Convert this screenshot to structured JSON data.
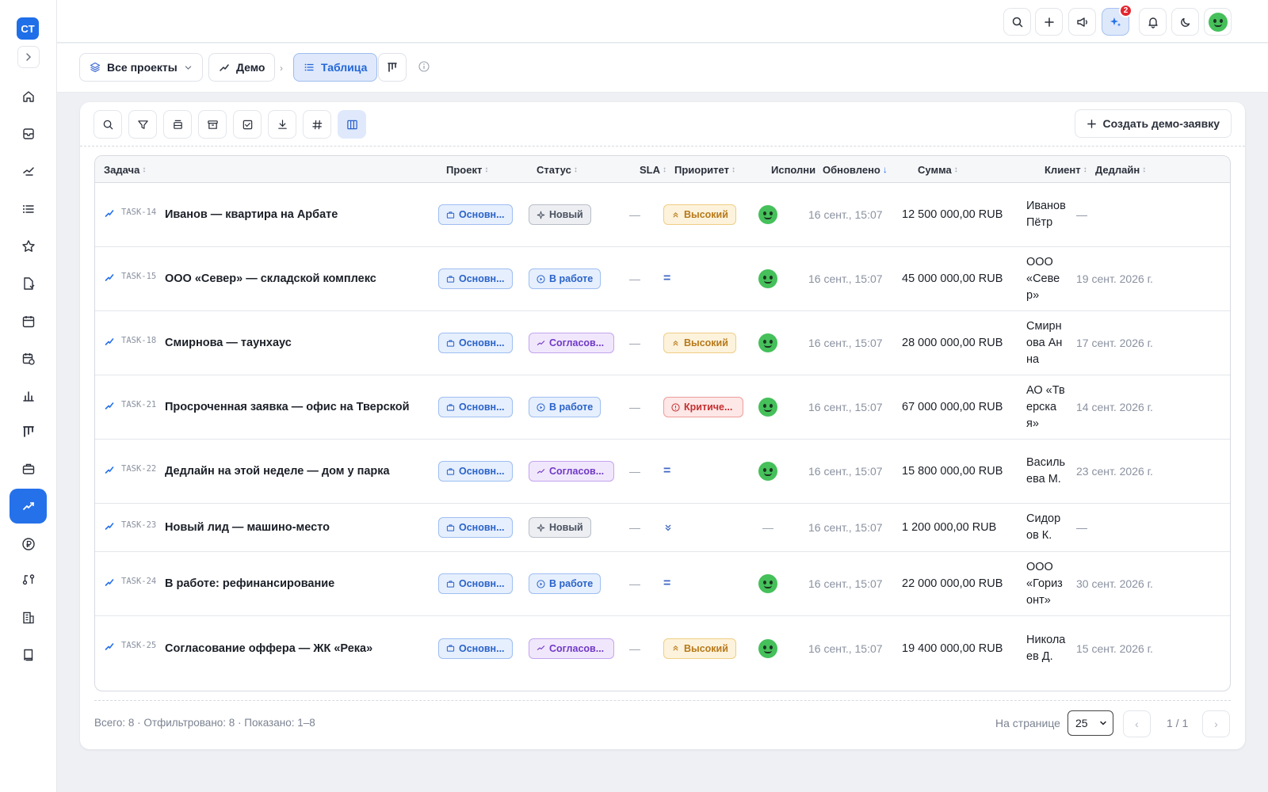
{
  "app": {
    "logo_text": "CT"
  },
  "sidebar": {
    "items": [
      {
        "icon": "home-icon"
      },
      {
        "icon": "inbox-icon"
      },
      {
        "icon": "handshake-icon"
      },
      {
        "icon": "list-icon"
      },
      {
        "icon": "star-icon"
      },
      {
        "icon": "document-icon"
      },
      {
        "icon": "calendar-icon"
      },
      {
        "icon": "calendar-clock-icon"
      },
      {
        "icon": "bar-chart-icon"
      },
      {
        "icon": "kanban-icon"
      },
      {
        "icon": "briefcase-icon"
      },
      {
        "icon": "deals-icon",
        "active": true
      },
      {
        "icon": "ruble-icon"
      },
      {
        "icon": "workflow-icon"
      },
      {
        "icon": "building-icon"
      },
      {
        "icon": "book-icon"
      }
    ]
  },
  "topbar": {
    "notification_count": "2"
  },
  "breadcrumb": {
    "projects": "Все проекты",
    "demo": "Демо",
    "table": "Таблица"
  },
  "toolbar": {
    "create_button": "Создать демо-заявку"
  },
  "table": {
    "columns": {
      "task": "Задача",
      "project": "Проект",
      "status": "Статус",
      "sla": "SLA",
      "priority": "Приоритет",
      "assignee": "Исполни",
      "updated": "Обновлено",
      "amount": "Сумма",
      "client": "Клиент",
      "deadline": "Дедлайн"
    },
    "rows": [
      {
        "id": "TASK-14",
        "title": "Иванов — квартира на Арбате",
        "project": "Основн...",
        "status": "Новый",
        "status_type": "new",
        "sla": "—",
        "priority": "Высокий",
        "priority_type": "high",
        "assignee": true,
        "updated": "16 сент., 15:07",
        "amount": "12 500 000,00 RUB",
        "client": "Иванов Пётр",
        "deadline": "—"
      },
      {
        "id": "TASK-15",
        "title": "ООО «Север» — складской комплекс",
        "project": "Основн...",
        "status": "В работе",
        "status_type": "work",
        "sla": "—",
        "priority": "=",
        "priority_type": "medium",
        "assignee": true,
        "updated": "16 сент., 15:07",
        "amount": "45 000 000,00 RUB",
        "client": "ООО «Север»",
        "deadline": "19 сент. 2026 г."
      },
      {
        "id": "TASK-18",
        "title": "Смирнова — таунхаус",
        "project": "Основн...",
        "status": "Согласов...",
        "status_type": "agree",
        "sla": "—",
        "priority": "Высокий",
        "priority_type": "high",
        "assignee": true,
        "updated": "16 сент., 15:07",
        "amount": "28 000 000,00 RUB",
        "client": "Смирнова Анна",
        "deadline": "17 сент. 2026 г."
      },
      {
        "id": "TASK-21",
        "title": "Просроченная заявка — офис на Тверской",
        "project": "Основн...",
        "status": "В работе",
        "status_type": "work",
        "sla": "—",
        "priority": "Критиче...",
        "priority_type": "critical",
        "assignee": true,
        "updated": "16 сент., 15:07",
        "amount": "67 000 000,00 RUB",
        "client": "АО «Тверская»",
        "deadline": "14 сент. 2026 г."
      },
      {
        "id": "TASK-22",
        "title": "Дедлайн на этой неделе — дом у парка",
        "project": "Основн...",
        "status": "Согласов...",
        "status_type": "agree",
        "sla": "—",
        "priority": "=",
        "priority_type": "medium",
        "assignee": true,
        "updated": "16 сент., 15:07",
        "amount": "15 800 000,00 RUB",
        "client": "Васильева М.",
        "deadline": "23 сент. 2026 г."
      },
      {
        "id": "TASK-23",
        "title": "Новый лид — машино-место",
        "project": "Основн...",
        "status": "Новый",
        "status_type": "new",
        "sla": "—",
        "priority": "low",
        "priority_type": "low",
        "assignee": false,
        "assignee_text": "—",
        "updated": "16 сент., 15:07",
        "amount": "1 200 000,00 RUB",
        "client": "Сидоров К.",
        "deadline": "—"
      },
      {
        "id": "TASK-24",
        "title": "В работе: рефинансирование",
        "project": "Основн...",
        "status": "В работе",
        "status_type": "work",
        "sla": "—",
        "priority": "=",
        "priority_type": "medium",
        "assignee": true,
        "updated": "16 сент., 15:07",
        "amount": "22 000 000,00 RUB",
        "client": "ООО «Горизонт»",
        "deadline": "30 сент. 2026 г."
      },
      {
        "id": "TASK-25",
        "title": "Согласование оффера — ЖК «Река»",
        "project": "Основн...",
        "status": "Согласов...",
        "status_type": "agree",
        "sla": "—",
        "priority": "Высокий",
        "priority_type": "high",
        "assignee": true,
        "updated": "16 сент., 15:07",
        "amount": "19 400 000,00 RUB",
        "client": "Николаев Д.",
        "deadline": "15 сент. 2026 г."
      }
    ]
  },
  "footer": {
    "info": "Всего: 8 · Отфильтровано: 8 · Показано: 1–8",
    "per_page_label": "На странице",
    "per_page_value": "25",
    "page_count": "1 / 1",
    "prev": "‹",
    "next": "›"
  },
  "colors": {
    "accent": "#2571ea",
    "badge": "#e3262f"
  }
}
